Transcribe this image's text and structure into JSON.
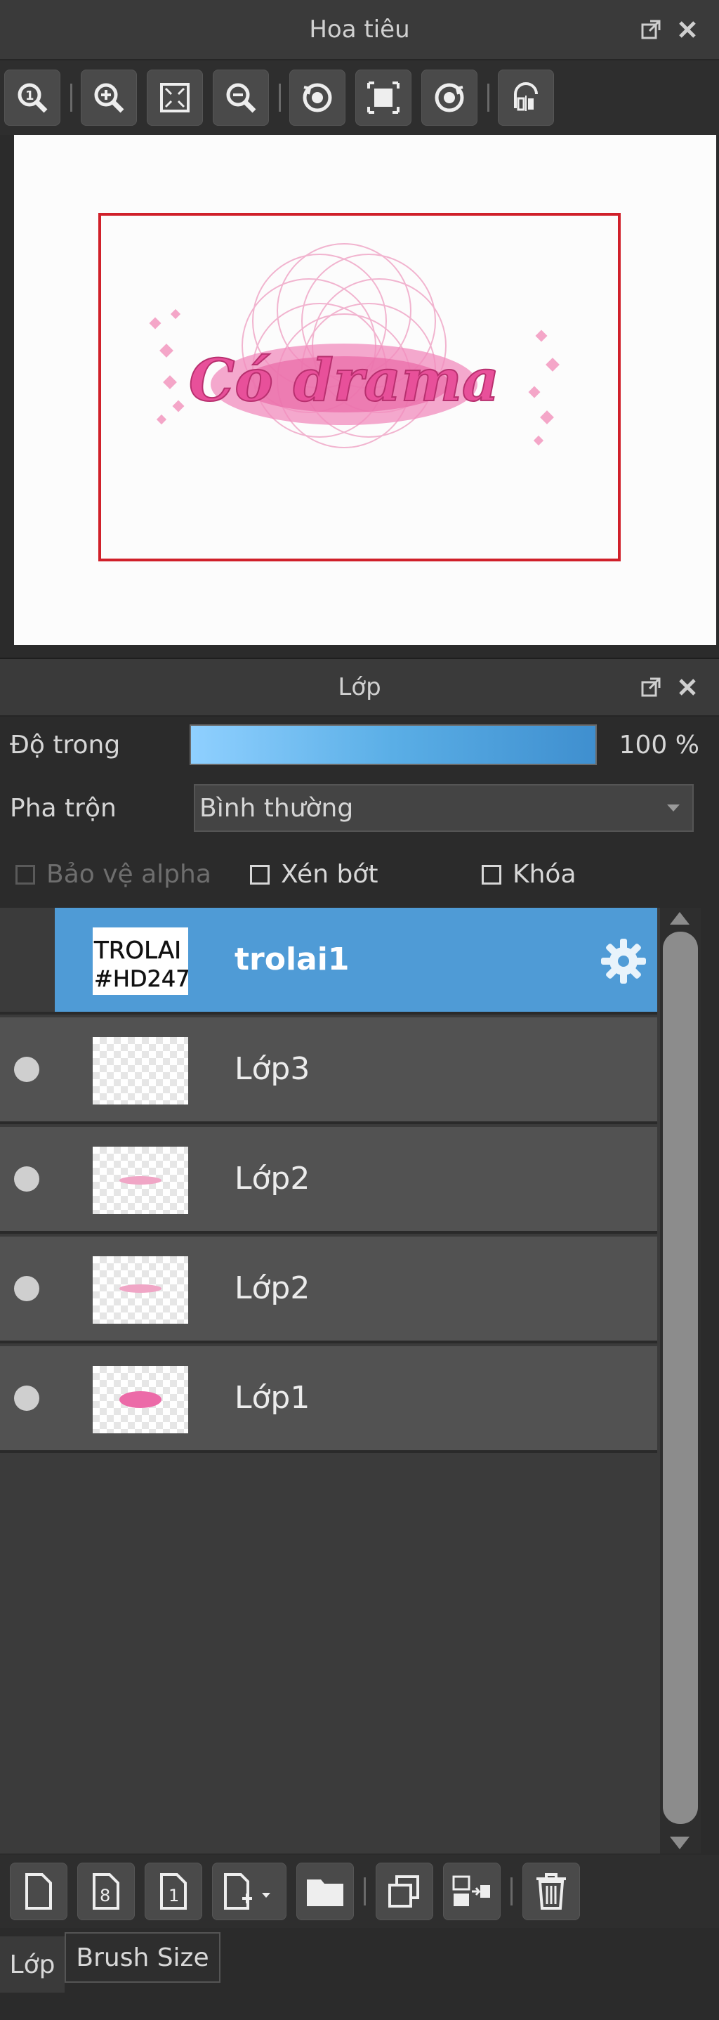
{
  "navigator": {
    "title": "Hoa tiêu",
    "preview_text": "Có drama",
    "toolbar_icons": [
      "zoom-100-icon",
      "zoom-in-icon",
      "fit-window-icon",
      "zoom-out-icon",
      "rotate-left-icon",
      "fit-canvas-icon",
      "rotate-right-icon",
      "flip-horizontal-icon"
    ]
  },
  "layers_panel": {
    "title": "Lớp",
    "opacity_label": "Độ trong",
    "opacity_value": "100 %",
    "opacity_fraction": 1.0,
    "blend_label": "Pha trộn",
    "blend_value": "Bình thường",
    "protect_alpha_label": "Bảo vệ alpha",
    "clipping_label": "Xén bớt",
    "lock_label": "Khóa",
    "layers": [
      {
        "name": "trolai1",
        "thumb_text_1": "TROLAI",
        "thumb_text_2": "#HD247",
        "selected": true
      },
      {
        "name": "Lớp3",
        "selected": false
      },
      {
        "name": "Lớp2",
        "selected": false
      },
      {
        "name": "Lớp2",
        "selected": false
      },
      {
        "name": "Lớp1",
        "selected": false
      }
    ]
  },
  "bottom_tabs": [
    "Lớp",
    "Brush Size"
  ],
  "colors": {
    "accent": "#4f9bd6",
    "selection_border": "#d0202a",
    "pink": "#e8509a"
  }
}
